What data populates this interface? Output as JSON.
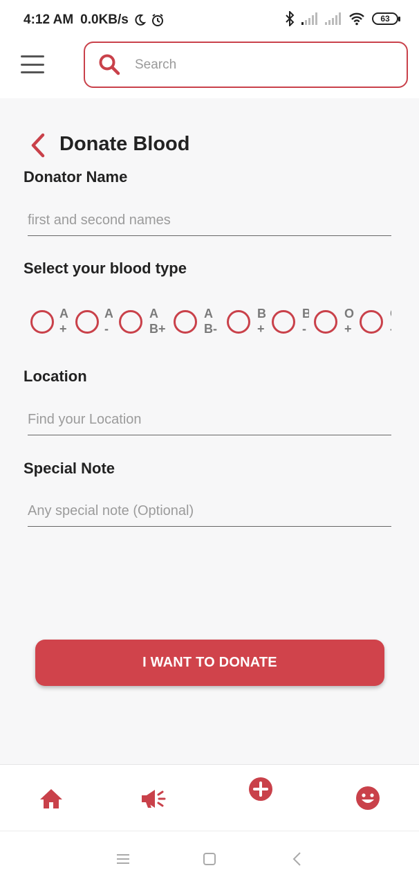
{
  "status_bar": {
    "time": "4:12 AM",
    "net_speed": "0.0KB/s",
    "battery": "63"
  },
  "header": {
    "search_placeholder": "Search"
  },
  "page": {
    "title": "Donate Blood"
  },
  "form": {
    "name_label": "Donator Name",
    "name_placeholder": "first and second names",
    "blood_label": "Select your blood type",
    "blood_types": [
      {
        "label": "A\n+"
      },
      {
        "label": "A\n-"
      },
      {
        "label": "A\nB+"
      },
      {
        "label": "A\nB-"
      },
      {
        "label": "B\n+"
      },
      {
        "label": "B\n-"
      },
      {
        "label": "O\n+"
      },
      {
        "label": "O\n-"
      }
    ],
    "location_label": "Location",
    "location_placeholder": "Find your Location",
    "note_label": "Special Note",
    "note_placeholder": "Any special note (Optional)",
    "submit_label": "I WANT TO DONATE"
  },
  "colors": {
    "accent": "#d0434b",
    "accent_dark": "#c9414a"
  },
  "icons": {
    "menu": "hamburger-icon",
    "search": "search-icon",
    "back": "chevron-left-icon",
    "tab_home": "home-icon",
    "tab_campaign": "megaphone-icon",
    "tab_add": "plus-circle-icon",
    "tab_profile": "smiley-icon"
  }
}
